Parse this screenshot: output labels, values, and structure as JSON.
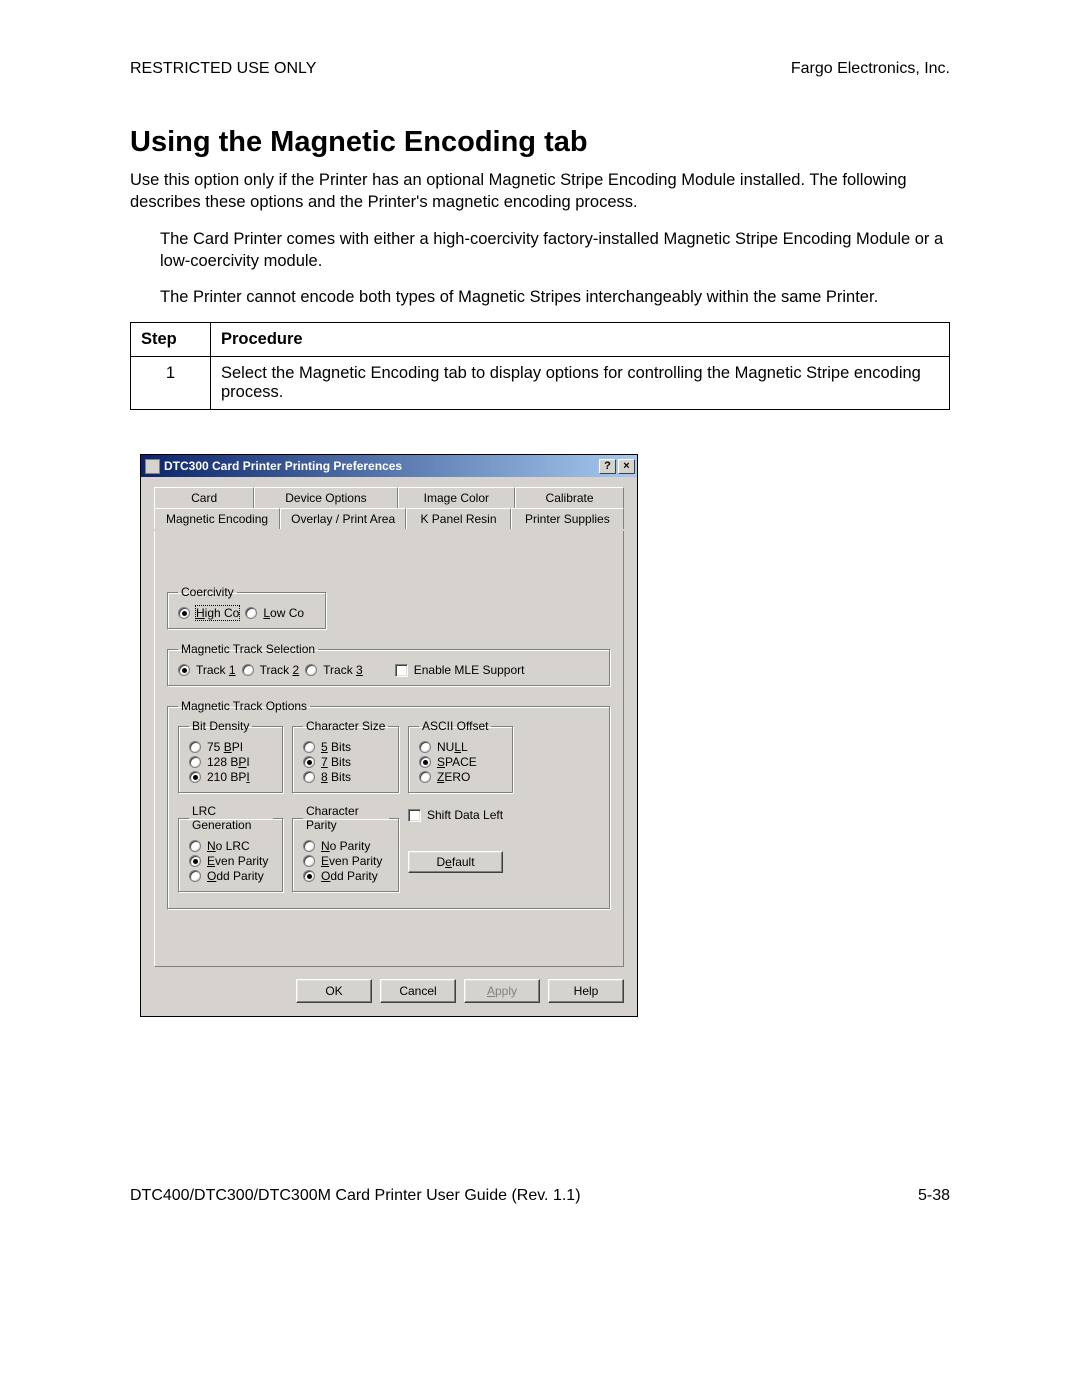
{
  "header": {
    "left": "RESTRICTED USE ONLY",
    "right": "Fargo Electronics, Inc."
  },
  "title": "Using the Magnetic Encoding tab",
  "intro": "Use this option only if the Printer has an optional Magnetic Stripe Encoding Module installed. The following describes these options and the Printer's magnetic encoding process.",
  "bullet1": "The Card Printer comes with either a high-coercivity factory-installed Magnetic Stripe Encoding Module or a low-coercivity module.",
  "bullet2": "The Printer cannot encode both types of Magnetic Stripes interchangeably within the same Printer.",
  "table": {
    "h1": "Step",
    "h2": "Procedure",
    "step": "1",
    "proc": "Select the Magnetic Encoding tab to display options for controlling the Magnetic Stripe encoding process."
  },
  "dialog": {
    "title": "DTC300 Card Printer Printing Preferences",
    "help_btn": "?",
    "close_btn": "×",
    "tabs_back": [
      "Card",
      "Device Options",
      "Image Color",
      "Calibrate"
    ],
    "tabs_front": [
      "Magnetic Encoding",
      "Overlay / Print Area",
      "K Panel Resin",
      "Printer Supplies"
    ],
    "coercivity": {
      "legend": "Coercivity",
      "high_pre": "H",
      "high_post": "igh Co",
      "low_pre": "L",
      "low_post": "ow Co"
    },
    "track_sel": {
      "legend": "Magnetic Track Selection",
      "t1a": "Track ",
      "t1b": "1",
      "t2a": "Track ",
      "t2b": "2",
      "t3a": "Track ",
      "t3b": "3",
      "mle": "Enable MLE Support"
    },
    "track_opt": {
      "legend": "Magnetic Track Options",
      "bit_density": {
        "legend": "Bit Density",
        "o1a": "  75 ",
        "o1b": "B",
        "o1c": "PI",
        "o2a": "128 B",
        "o2b": "P",
        "o2c": "I",
        "o3a": "210 BP",
        "o3b": "I",
        "o3c": ""
      },
      "char_size": {
        "legend": "Character Size",
        "o1b": "5",
        "o1c": " Bits",
        "o2b": "7",
        "o2c": " Bits",
        "o3b": "8",
        "o3c": " Bits"
      },
      "ascii": {
        "legend": "ASCII Offset",
        "o1a": "NU",
        "o1b": "L",
        "o1c": "L",
        "o2b": "S",
        "o2c": "PACE",
        "o3b": "Z",
        "o3c": "ERO"
      },
      "lrc": {
        "legend": "LRC Generation",
        "o1b": "N",
        "o1c": "o LRC",
        "o2b": "E",
        "o2c": "ven Parity",
        "o3b": "O",
        "o3c": "dd Parity"
      },
      "char_parity": {
        "legend": "Character Parity",
        "o1b": "N",
        "o1c": "o Parity",
        "o2b": "E",
        "o2c": "ven Parity",
        "o3b": "O",
        "o3c": "dd Parity"
      },
      "shift": "Shift Data Left",
      "default_pre": "D",
      "default_u": "e",
      "default_post": "fault"
    },
    "buttons": {
      "ok": "OK",
      "cancel": "Cancel",
      "apply_pre": "A",
      "apply_u": "",
      "apply_post": "pply",
      "help": "Help"
    }
  },
  "footer": {
    "left": "DTC400/DTC300/DTC300M Card Printer User Guide (Rev. 1.1)",
    "right": "5-38"
  }
}
